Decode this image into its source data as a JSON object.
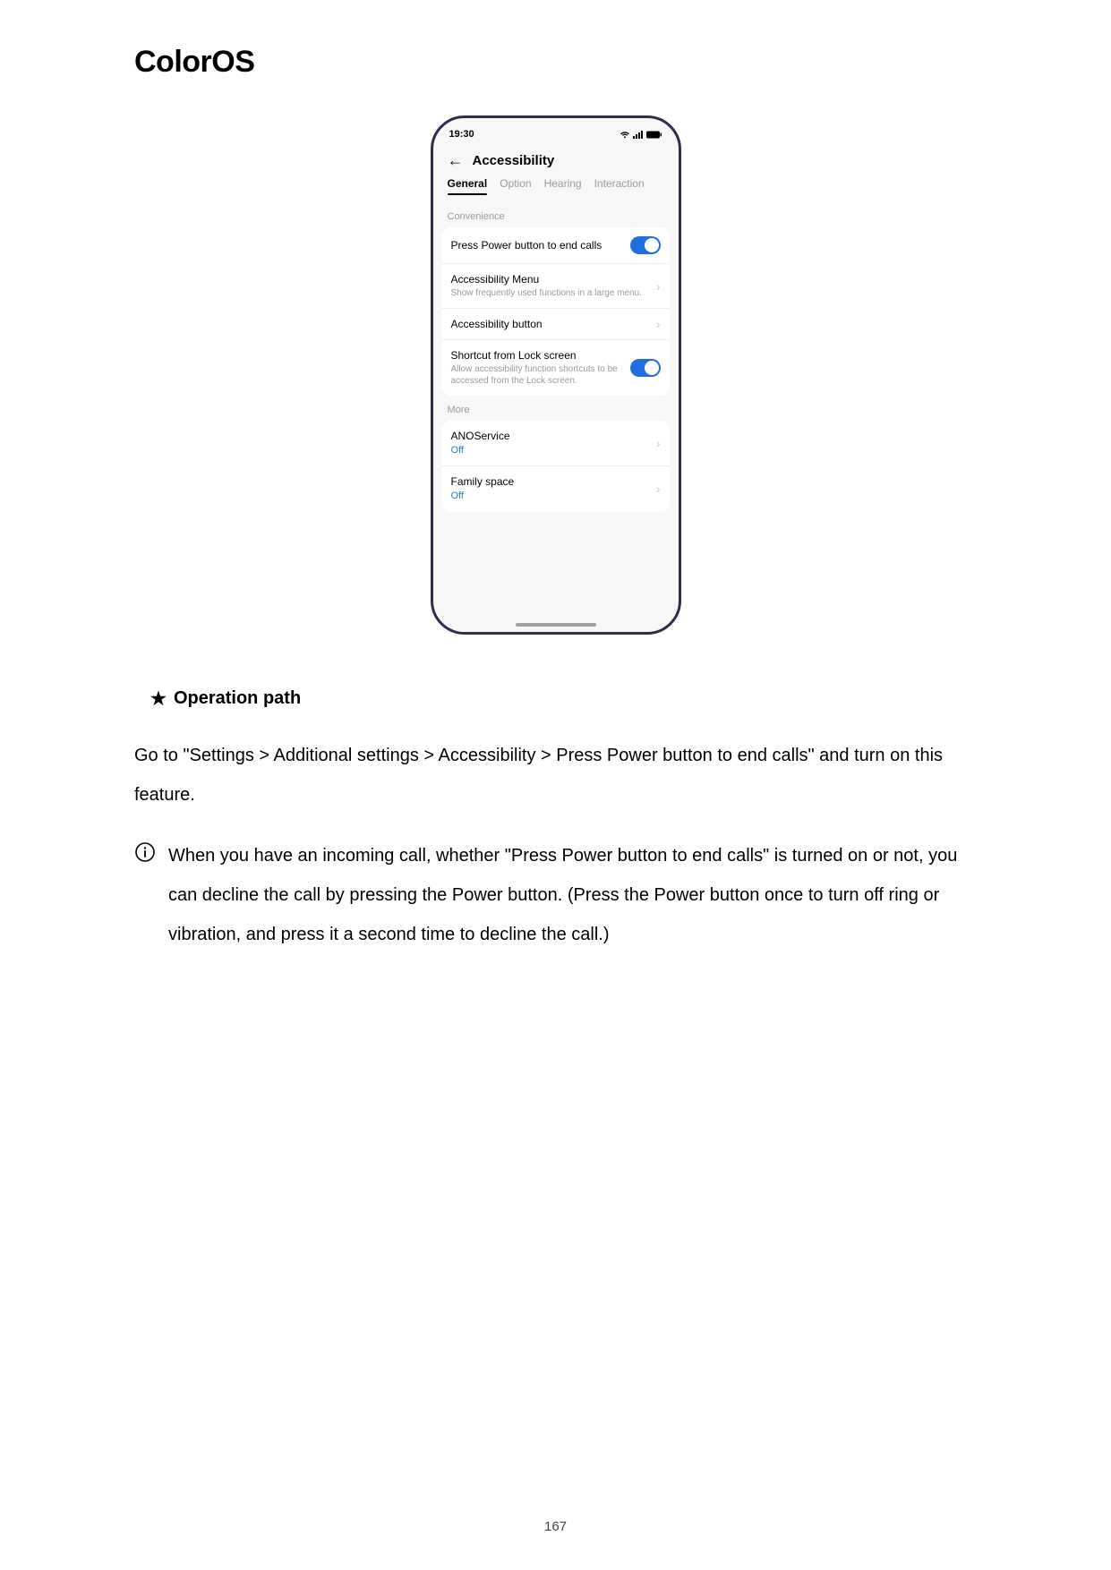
{
  "brand": "ColorOS",
  "phone": {
    "status_time": "19:30",
    "screen_title": "Accessibility",
    "tabs": [
      "General",
      "Option",
      "Hearing",
      "Interaction"
    ],
    "active_tab_index": 0,
    "section1_label": "Convenience",
    "rows": {
      "power_end_calls": {
        "title": "Press Power button to end calls",
        "toggle_on": true
      },
      "accessibility_menu": {
        "title": "Accessibility Menu",
        "subtitle": "Show frequently used functions in a large menu."
      },
      "accessibility_button": {
        "title": "Accessibility button"
      },
      "shortcut_lock": {
        "title": "Shortcut from Lock screen",
        "subtitle": "Allow accessibility function shortcuts to be accessed from the Lock screen.",
        "toggle_on": true
      }
    },
    "section2_label": "More",
    "more_rows": {
      "ano": {
        "title": "ANOService",
        "status": "Off"
      },
      "family": {
        "title": "Family space",
        "status": "Off"
      }
    }
  },
  "operation_heading": "Operation path",
  "operation_body": "Go to \"Settings > Additional settings > Accessibility > Press Power button to end calls\" and turn on this feature.",
  "info_note": "When you have an incoming call, whether \"Press Power button to end calls\" is turned on or not, you can decline the call by pressing the Power button. (Press the Power button once to turn off ring or vibration, and press it a second time to decline the call.)",
  "page_number": "167"
}
